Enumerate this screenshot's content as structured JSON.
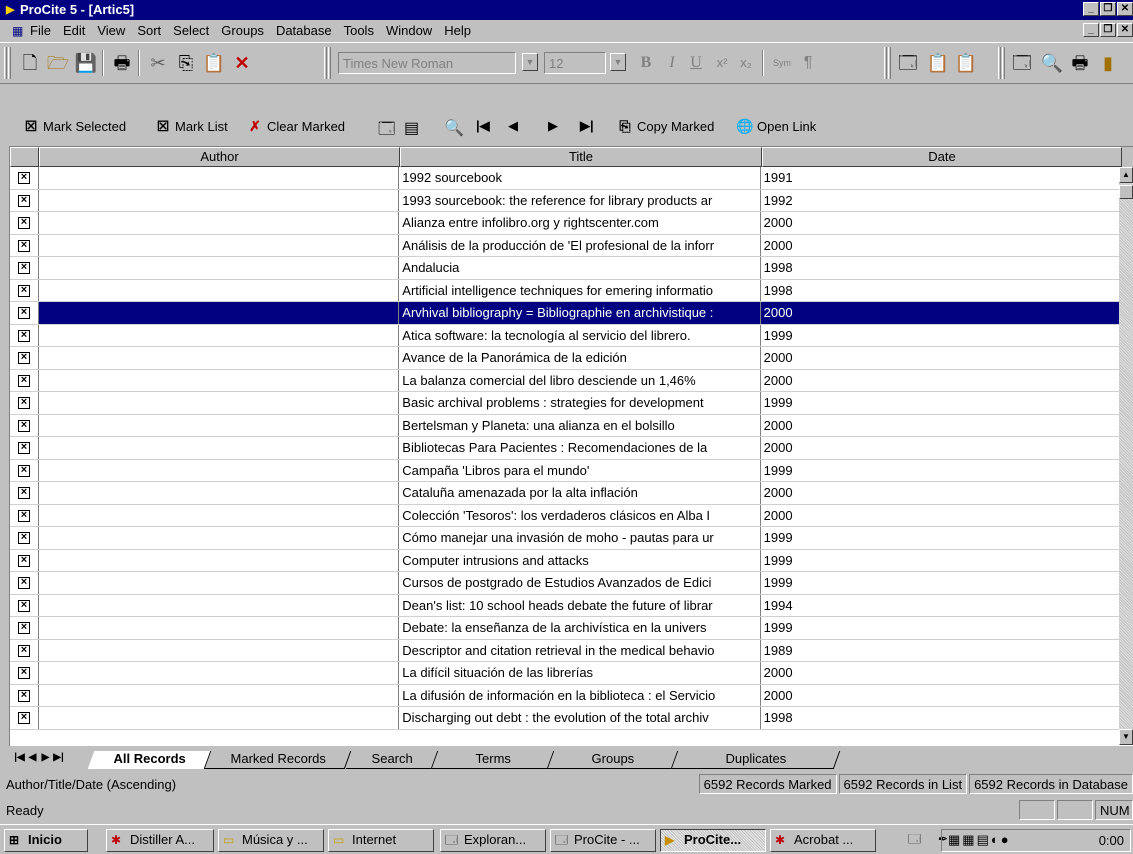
{
  "window": {
    "title": "ProCite 5 - [Artic5]"
  },
  "menu": [
    "File",
    "Edit",
    "View",
    "Sort",
    "Select",
    "Groups",
    "Database",
    "Tools",
    "Window",
    "Help"
  ],
  "toolbar1": {
    "font_name": "Times New Roman",
    "font_size": "12",
    "sym_label": "Sym",
    "para_label": "¶"
  },
  "toolbar2": {
    "mark_selected": "Mark Selected",
    "mark_list": "Mark List",
    "clear_marked": "Clear Marked",
    "copy_marked": "Copy Marked",
    "open_link": "Open Link"
  },
  "grid": {
    "columns": [
      "Author",
      "Title",
      "Date"
    ],
    "rows": [
      {
        "author": "",
        "title": "1992 sourcebook",
        "date": "1991"
      },
      {
        "author": "",
        "title": "1993 sourcebook: the reference for library products ar",
        "date": "1992"
      },
      {
        "author": "",
        "title": "Alianza entre infolibro.org y rightscenter.com",
        "date": "2000"
      },
      {
        "author": "",
        "title": "Análisis de la producción de 'El profesional de la inforr",
        "date": "2000"
      },
      {
        "author": "",
        "title": "Andalucia",
        "date": "1998"
      },
      {
        "author": "",
        "title": "Artificial intelligence techniques for emering informatio",
        "date": "1998"
      },
      {
        "author": "",
        "title": "Arvhival bibliography = Bibliographie en archivistique :",
        "date": "2000"
      },
      {
        "author": "",
        "title": "Atica software: la tecnología al servicio del librero.",
        "date": "1999"
      },
      {
        "author": "",
        "title": "Avance de la Panorámica de la edición",
        "date": "2000"
      },
      {
        "author": "",
        "title": "La balanza comercial del libro desciende un 1,46%",
        "date": "2000"
      },
      {
        "author": "",
        "title": "Basic archival problems : strategies for development",
        "date": "1999"
      },
      {
        "author": "",
        "title": "Bertelsman y Planeta: una alianza en el bolsillo",
        "date": "2000"
      },
      {
        "author": "",
        "title": "Bibliotecas Para Pacientes : Recomendaciones de la",
        "date": "2000"
      },
      {
        "author": "",
        "title": "Campaña 'Libros para el mundo'",
        "date": "1999"
      },
      {
        "author": "",
        "title": "Cataluña amenazada por la alta inflación",
        "date": "2000"
      },
      {
        "author": "",
        "title": "Colección 'Tesoros': los verdaderos clásicos en Alba I",
        "date": "2000"
      },
      {
        "author": "",
        "title": "Cómo manejar una invasión de moho - pautas para ur",
        "date": "1999"
      },
      {
        "author": "",
        "title": "Computer intrusions and attacks",
        "date": "1999"
      },
      {
        "author": "",
        "title": "Cursos de postgrado de Estudios Avanzados de Edici",
        "date": "1999"
      },
      {
        "author": "",
        "title": "Dean's list: 10 school heads debate the future of librar",
        "date": "1994"
      },
      {
        "author": "",
        "title": "Debate: la enseñanza de la archivística en la univers",
        "date": "1999"
      },
      {
        "author": "",
        "title": "Descriptor and citation retrieval in the medical behavio",
        "date": "1989"
      },
      {
        "author": "",
        "title": "La difícil situación de las librerías",
        "date": "2000"
      },
      {
        "author": "",
        "title": "La difusión de información en la biblioteca : el Servicio",
        "date": "2000"
      },
      {
        "author": "",
        "title": "Discharging out debt : the evolution of the total archiv",
        "date": "1998"
      }
    ],
    "mark_glyph": "×"
  },
  "tabs": [
    "All Records",
    "Marked Records",
    "Search",
    "Terms",
    "Groups",
    "Duplicates"
  ],
  "status": {
    "sort": "Author/Title/Date (Ascending)",
    "marked": "6592 Records Marked",
    "in_list": "6592 Records in List",
    "in_db": "6592 Records in Database",
    "ready": "Ready",
    "num": "NUM"
  },
  "taskbar": {
    "start": "Inicio",
    "tasks": [
      "Distiller A...",
      "Música y ...",
      "Internet",
      "Exploran...",
      "ProCite - ...",
      "ProCite...",
      "Acrobat ..."
    ],
    "clock": "0:00"
  }
}
